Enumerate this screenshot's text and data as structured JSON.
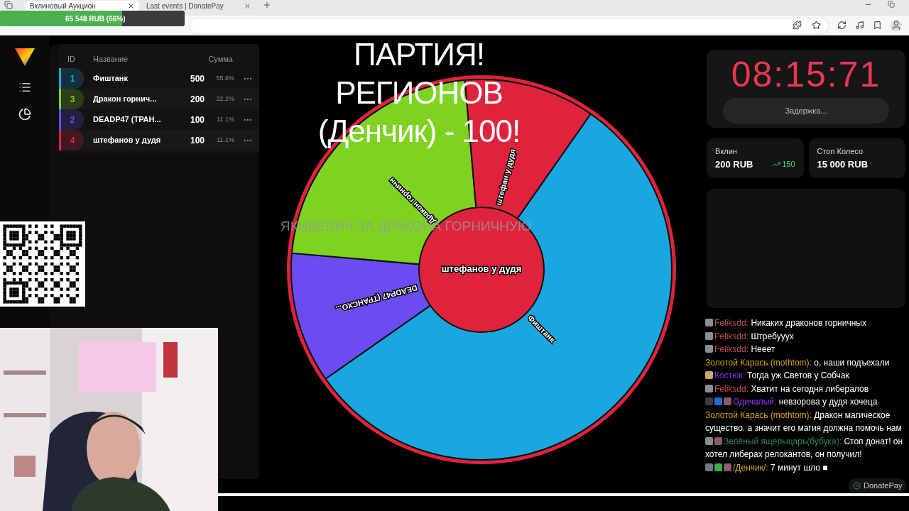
{
  "browser": {
    "tabs": [
      {
        "label": "Вклиновый Аукцион",
        "selected": true
      },
      {
        "label": "Last events | DonatePay",
        "selected": false
      }
    ]
  },
  "progress_overlay": {
    "text": "65 548 RUB (66%)",
    "level": 0.66
  },
  "table": {
    "columns": [
      "ID",
      "Название",
      "Сумма"
    ],
    "rows": [
      {
        "id": "1",
        "name": "Фиштанк",
        "amount": "500",
        "percent": "55.6%",
        "color": "#1aa7e0"
      },
      {
        "id": "3",
        "name": "Дракон горнич...",
        "amount": "200",
        "percent": "22.2%",
        "color": "#7ed321"
      },
      {
        "id": "2",
        "name": "DEADP47 (ТРАН...",
        "amount": "100",
        "percent": "11.1%",
        "color": "#6a4cf0"
      },
      {
        "id": "4",
        "name": "штефанов у дудя",
        "amount": "100",
        "percent": "11.1%",
        "color": "#e0233d"
      }
    ]
  },
  "wheel": {
    "segments": [
      {
        "label": "Фиштанк",
        "color": "#1aa7e0"
      },
      {
        "label": "DEADP47 (ТРАНСХО...",
        "color": "#6a4cf0"
      },
      {
        "label": "Дракон горничн",
        "color": "#7ed321"
      },
      {
        "label": "штефан у дудя",
        "color": "#e0233d"
      }
    ],
    "center_label": "штефанов у дудя"
  },
  "alert_title": [
    "ПАРТИЯ!",
    "РЕГИОНОВ",
    "(Денчик) - 100!"
  ],
  "alert_caption": "ЯКИБЕВИЧ ЗА ДРАКОНА ГОРНИЧНУЮ",
  "timer": {
    "time": "08:15:71",
    "button": "Задержка..."
  },
  "stats": [
    {
      "label": "Вклин",
      "value": "200 RUB",
      "delta": "150"
    },
    {
      "label": "Стоп Колесо",
      "value": "15 000 RUB"
    }
  ],
  "chat": [
    {
      "name": "Feliksdd:",
      "color": "#c0504d",
      "text": "Никаких драконов горничных",
      "badges": [
        {
          "color": "#8a8f96"
        }
      ]
    },
    {
      "name": "Feliksdd:",
      "color": "#c0504d",
      "text": "Штребуууx",
      "badges": [
        {
          "color": "#8a8f96"
        }
      ]
    },
    {
      "name": "Feliksdd:",
      "color": "#c0504d",
      "text": "Нееет",
      "badges": [
        {
          "color": "#8a8f96"
        }
      ]
    },
    {
      "name": "Золотой Карась (mothtom):",
      "color": "#daa520",
      "text": "о, наши подъехали"
    },
    {
      "name": "Костюк:",
      "color": "#8a2be2",
      "text": "Тогда уж Светов у Собчак",
      "badges": [
        {
          "color": "#c9a66b"
        }
      ]
    },
    {
      "name": "Feliksdd:",
      "color": "#c0504d",
      "text": "Хватит на сегодня либералов",
      "badges": [
        {
          "color": "#8a8f96"
        }
      ]
    },
    {
      "name": "Одичалый:",
      "color": "#9b30ff",
      "text": "невзорова у дудя хочеца",
      "badges": [
        {
          "color": "#3a3a4a"
        },
        {
          "color": "#1e6fd9"
        },
        {
          "color": "#8b5a6b"
        }
      ]
    },
    {
      "name": "Золотой Карась (mothtom):",
      "color": "#daa520",
      "text": "Дракон магическое существо. а значит его магия должна помочь нам"
    },
    {
      "name": "Зелёный ящерыцарь(бубука):",
      "color": "#2e8b57",
      "text": "Стоп донат! он хотел либерах релокантов, он получил!",
      "badges": [
        {
          "color": "#8a8f96"
        },
        {
          "color": "#8b5a6b"
        }
      ]
    },
    {
      "name": "/Денчик/:",
      "color": "#daa520",
      "text": "7 минут шло ■",
      "badges": [
        {
          "color": "#6b7a8a"
        },
        {
          "color": "#3cb043"
        },
        {
          "color": "#8b5a6b"
        }
      ]
    }
  ],
  "donate_badge": "DonatePay"
}
